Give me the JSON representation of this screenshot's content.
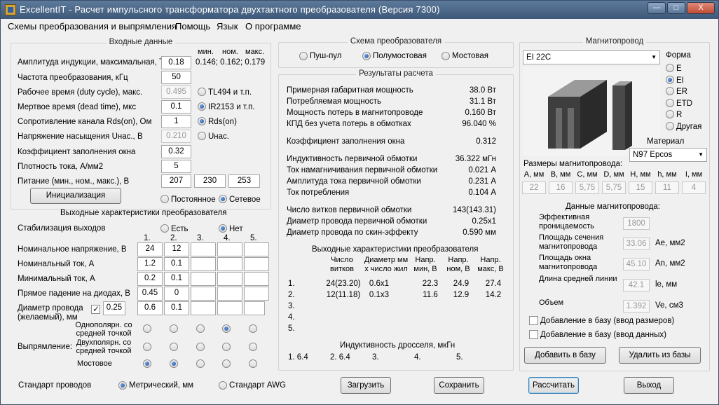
{
  "window": {
    "title": "ExcellentIT - Расчет импульсного трансформатора двухтактного преобразователя (Версия 7300)",
    "btn_min": "—",
    "btn_max": "□",
    "btn_close": "X"
  },
  "menu": [
    "Схемы преобразования и выпрямления",
    "Помощь",
    "Язык",
    "О программе"
  ],
  "input": {
    "group_title": "Входные данные",
    "hdr_min": "мин.",
    "hdr_nom": "ном.",
    "hdr_max": "макс.",
    "bmax_label": "Амплитуда индукции, максимальная, Т",
    "bmax": "0.18",
    "bmax_range": "0.146; 0.162; 0.179",
    "freq_label": "Частота преобразования, кГц",
    "freq": "50",
    "duty_label": "Рабочее время (duty cycle), макс.",
    "duty": "0.495",
    "dead_label": "Мертвое время (dead time), мкс",
    "dead": "0.1",
    "rds_label": "Сопротивление канала Rds(on), Ом",
    "rds": "1",
    "usat_label": "Напряжение насыщения Uнас., В",
    "usat": "0.210",
    "fill_label": "Коэффициент заполнения окна",
    "fill": "0.32",
    "j_label": "Плотность тока, А/мм2",
    "j": "5",
    "supply_label": "Питание (мин., ном., макс.), В",
    "supply_min": "207",
    "supply_nom": "230",
    "supply_max": "253",
    "drv_tl494": "TL494 и т.п.",
    "drv_ir2153": "IR2153 и т.п.",
    "drv_rds": "Rds(on)",
    "drv_usat": "Uнас.",
    "init_btn": "Инициализация",
    "supply_dc": "Постоянное",
    "supply_ac": "Сетевое"
  },
  "outputs": {
    "title": "Выходные характеристики преобразователя",
    "stab_label": "Стабилизация выходов",
    "stab_yes": "Есть",
    "stab_no": "Нет",
    "cols": [
      "1.",
      "2.",
      "3.",
      "4.",
      "5."
    ],
    "rows": [
      {
        "label": "Номинальное напряжение, В",
        "v": [
          "24",
          "12",
          "",
          "",
          ""
        ]
      },
      {
        "label": "Номинальный ток, А",
        "v": [
          "1.2",
          "0.1",
          "",
          "",
          ""
        ]
      },
      {
        "label": "Минимальный ток, А",
        "v": [
          "0.2",
          "0.1",
          "",
          "",
          ""
        ]
      },
      {
        "label": "Прямое падение на диодах, В",
        "v": [
          "0.45",
          "0",
          "",
          "",
          ""
        ]
      },
      {
        "label": "Диаметр провода (желаемый), мм",
        "v": [
          "0.25",
          "0.6",
          "0.1",
          "",
          ""
        ]
      }
    ],
    "rect_label": "Выпрямление:",
    "rect_types": [
      "Однополярн. со средней точкой",
      "Двухполярн. со средней точкой",
      "Мостовое"
    ]
  },
  "scheme": {
    "title": "Схема преобразователя",
    "opts": [
      "Пуш-пул",
      "Полумостовая",
      "Мостовая"
    ],
    "selected": 1
  },
  "results": {
    "title": "Результаты расчета",
    "lines": [
      {
        "label": "Примерная габаритная мощность",
        "value": "38.0 Вт"
      },
      {
        "label": "Потребляемая мощность",
        "value": "31.1 Вт"
      },
      {
        "label": "Мощность потерь в магнитопроводе",
        "value": "0.160 Вт"
      },
      {
        "label": "КПД без учета потерь в обмотках",
        "value": "96.040 %"
      },
      {
        "label": "Коэффициент заполнения окна",
        "value": "0.312"
      },
      {
        "label": "Индуктивность первичной обмотки",
        "value": "36.322 мГн"
      },
      {
        "label": "Ток намагничивания первичной обмотки",
        "value": "0.021 А"
      },
      {
        "label": "Амплитуда тока первичной обмотки",
        "value": "0.231 А"
      },
      {
        "label": "Ток потребления",
        "value": "0.104 А"
      },
      {
        "label": "Число витков первичной обмотки",
        "value": "143(143.31)"
      },
      {
        "label": "Диаметр провода первичной обмотки",
        "value": "0.25x1"
      },
      {
        "label": "Диаметр провода по скин-эффекту",
        "value": "0.590 мм"
      }
    ],
    "out_title": "Выходные характеристики преобразователя",
    "out_hdr": [
      "Число витков",
      "Диаметр мм х число жил",
      "Напр. мин, В",
      "Напр. ном, В",
      "Напр. макс, В"
    ],
    "out_rows": [
      {
        "n": "1.",
        "turns": "24(23.20)",
        "wire": "0.6x1",
        "umin": "22.3",
        "unom": "24.9",
        "umax": "27.4"
      },
      {
        "n": "2.",
        "turns": "12(11.18)",
        "wire": "0.1x3",
        "umin": "11.6",
        "unom": "12.9",
        "umax": "14.2"
      },
      {
        "n": "3.",
        "turns": "",
        "wire": "",
        "umin": "",
        "unom": "",
        "umax": ""
      },
      {
        "n": "4.",
        "turns": "",
        "wire": "",
        "umin": "",
        "unom": "",
        "umax": ""
      },
      {
        "n": "5.",
        "turns": "",
        "wire": "",
        "umin": "",
        "unom": "",
        "umax": ""
      }
    ],
    "choke_title": "Индуктивность дросселя, мкГн",
    "choke": [
      "1. 6.4",
      "2. 6.4",
      "3.",
      "4.",
      "5."
    ]
  },
  "core": {
    "title": "Магнитопровод",
    "selected": "EI 22C",
    "form_label": "Форма",
    "forms": [
      "E",
      "EI",
      "ER",
      "ETD",
      "R",
      "Другая"
    ],
    "form_selected": 1,
    "material_label": "Материал",
    "material": "N97 Epcos",
    "dims_label": "Размеры магнитопровода:",
    "dims_hdr": [
      "A, мм",
      "B, мм",
      "C, мм",
      "D, мм",
      "H, мм",
      "h, мм",
      "I, мм"
    ],
    "dims": [
      "22",
      "16",
      "5,75",
      "5,75",
      "15",
      "11",
      "4"
    ],
    "data_label": "Данные магнитопровода:",
    "props": [
      {
        "label": "Эффективная проницаемость",
        "value": "1800",
        "unit": ""
      },
      {
        "label": "Площадь сечения магнитопровода",
        "value": "33.06",
        "unit": "Ae, мм2"
      },
      {
        "label": "Площадь окна магнитопровода",
        "value": "45.10",
        "unit": "An, мм2"
      },
      {
        "label": "Длина средней линии",
        "value": "42.1",
        "unit": "le, мм"
      },
      {
        "label": "Объем",
        "value": "1.392",
        "unit": "Ve, см3"
      }
    ],
    "add_dims": "Добавление в базу (ввод размеров)",
    "add_data": "Добавление в базу (ввод данных)",
    "add_btn": "Добавить в базу",
    "del_btn": "Удалить из базы"
  },
  "footer": {
    "wire_std": "Стандарт проводов",
    "metric": "Метрический, мм",
    "awg": "Стандарт AWG",
    "load": "Загрузить",
    "save": "Сохранить",
    "calc": "Рассчитать",
    "exit": "Выход"
  }
}
